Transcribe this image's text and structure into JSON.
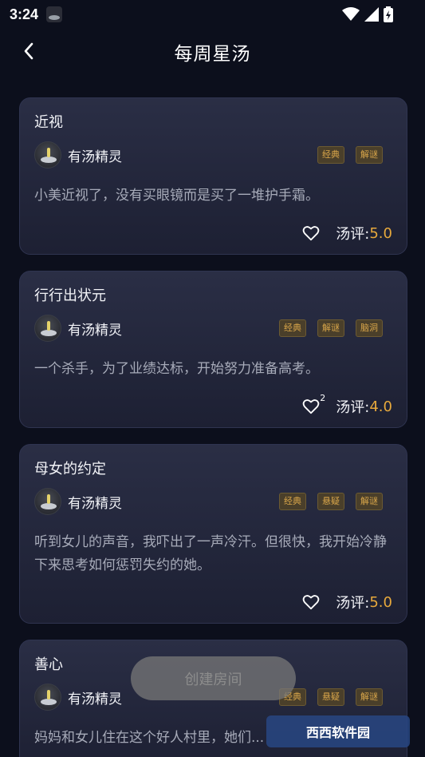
{
  "status": {
    "time": "3:24"
  },
  "header": {
    "title": "每周星汤"
  },
  "cards": [
    {
      "title": "近视",
      "author": "有汤精灵",
      "tags": [
        "经典",
        "解谜"
      ],
      "desc": "小美近视了，没有买眼镜而是买了一堆护手霜。",
      "rating_label": "汤评:",
      "rating_value": "5.0"
    },
    {
      "title": "行行出状元",
      "author": "有汤精灵",
      "tags": [
        "经典",
        "解谜",
        "脑洞"
      ],
      "desc": "一个杀手，为了业绩达标，开始努力准备高考。",
      "likes": "2",
      "rating_label": "汤评:",
      "rating_value": "4.0"
    },
    {
      "title": "母女的约定",
      "author": "有汤精灵",
      "tags": [
        "经典",
        "悬疑",
        "解谜"
      ],
      "desc": "听到女儿的声音，我吓出了一声冷汗。但很快，我开始冷静下来思考如何惩罚失约的她。",
      "rating_label": "汤评:",
      "rating_value": "5.0"
    },
    {
      "title": "善心",
      "author": "有汤精灵",
      "tags": [
        "经典",
        "悬疑",
        "解谜"
      ],
      "desc": "妈妈和女儿住在这个好人村里，她们..."
    }
  ],
  "create_room": "创建房间",
  "watermark": "西西软件园",
  "colors": {
    "background": "#0c0f1c",
    "card": "#2a2e45",
    "accent": "#e7a93c",
    "tag_text": "#d9a64a"
  }
}
